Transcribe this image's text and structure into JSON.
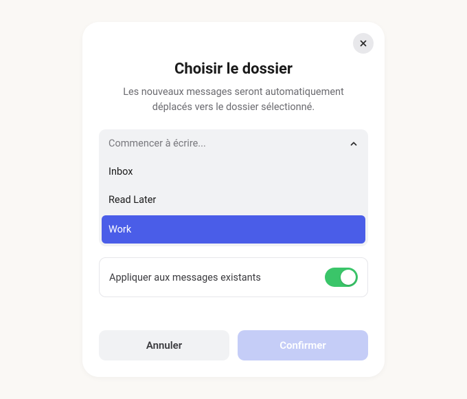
{
  "dialog": {
    "title": "Choisir le dossier",
    "subtitle": "Les nouveaux messages seront automatiquement déplacés vers le dossier sélectionné.",
    "search_placeholder": "Commencer à écrire...",
    "options": [
      {
        "label": "Inbox",
        "selected": false
      },
      {
        "label": "Read Later",
        "selected": false
      },
      {
        "label": "Work",
        "selected": true
      }
    ],
    "toggle": {
      "label": "Appliquer aux messages existants",
      "on": true
    },
    "buttons": {
      "cancel": "Annuler",
      "confirm": "Confirmer"
    }
  }
}
